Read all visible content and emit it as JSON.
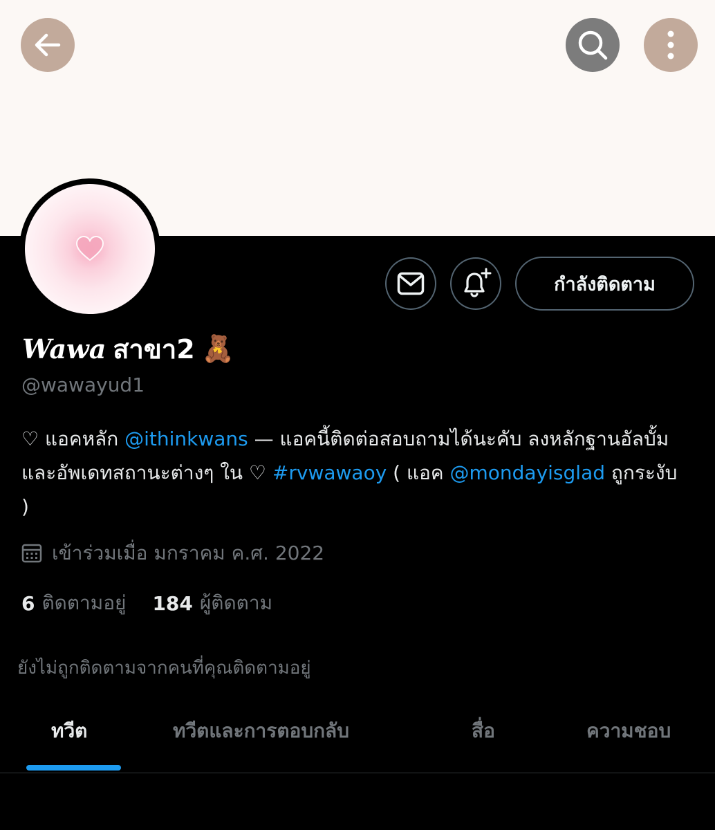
{
  "header": {
    "back_icon": "arrow-left-icon",
    "search_icon": "search-icon",
    "more_icon": "more-vertical-icon",
    "banner_color": "#fcf8f5"
  },
  "profile": {
    "name_script": "Wawa",
    "name_thai": "สาขา2",
    "name_emoji": "🧸",
    "handle": "@wawayud1",
    "avatar_icon": "heart-icon"
  },
  "actions": {
    "message_icon": "mail-icon",
    "notify_icon": "bell-plus-icon",
    "follow_label": "กำลังติดตาม"
  },
  "bio": {
    "part1": "♡ แอคหลัก ",
    "mention1": "@ithinkwans",
    "part2": " — แอคนี้ติดต่อสอบถามได้นะคับ ลงหลักฐานอัลบั้มและอัพเดทสถานะต่างๆ ใน ♡ ",
    "hashtag": "#rvwawaoy",
    "part3": " ( แอค ",
    "mention2": "@mondayisglad",
    "part4": " ถูกระงับ )"
  },
  "joined": {
    "icon": "calendar-icon",
    "text": "เข้าร่วมเมื่อ มกราคม ค.ศ. 2022"
  },
  "stats": {
    "following_count": "6",
    "following_label": "ติดตามอยู่",
    "followers_count": "184",
    "followers_label": "ผู้ติดตาม"
  },
  "not_followed_text": "ยังไม่ถูกติดตามจากคนที่คุณติดตามอยู่",
  "tabs": [
    {
      "label": "ทวีต",
      "active": true
    },
    {
      "label": "ทวีตและการตอบกลับ",
      "active": false
    },
    {
      "label": "สื่อ",
      "active": false
    },
    {
      "label": "ความชอบ",
      "active": false
    }
  ],
  "colors": {
    "accent": "#1d9bf0",
    "muted": "#71767b",
    "button_brown": "#c2aa9b",
    "button_gray": "#7c7c7c"
  }
}
